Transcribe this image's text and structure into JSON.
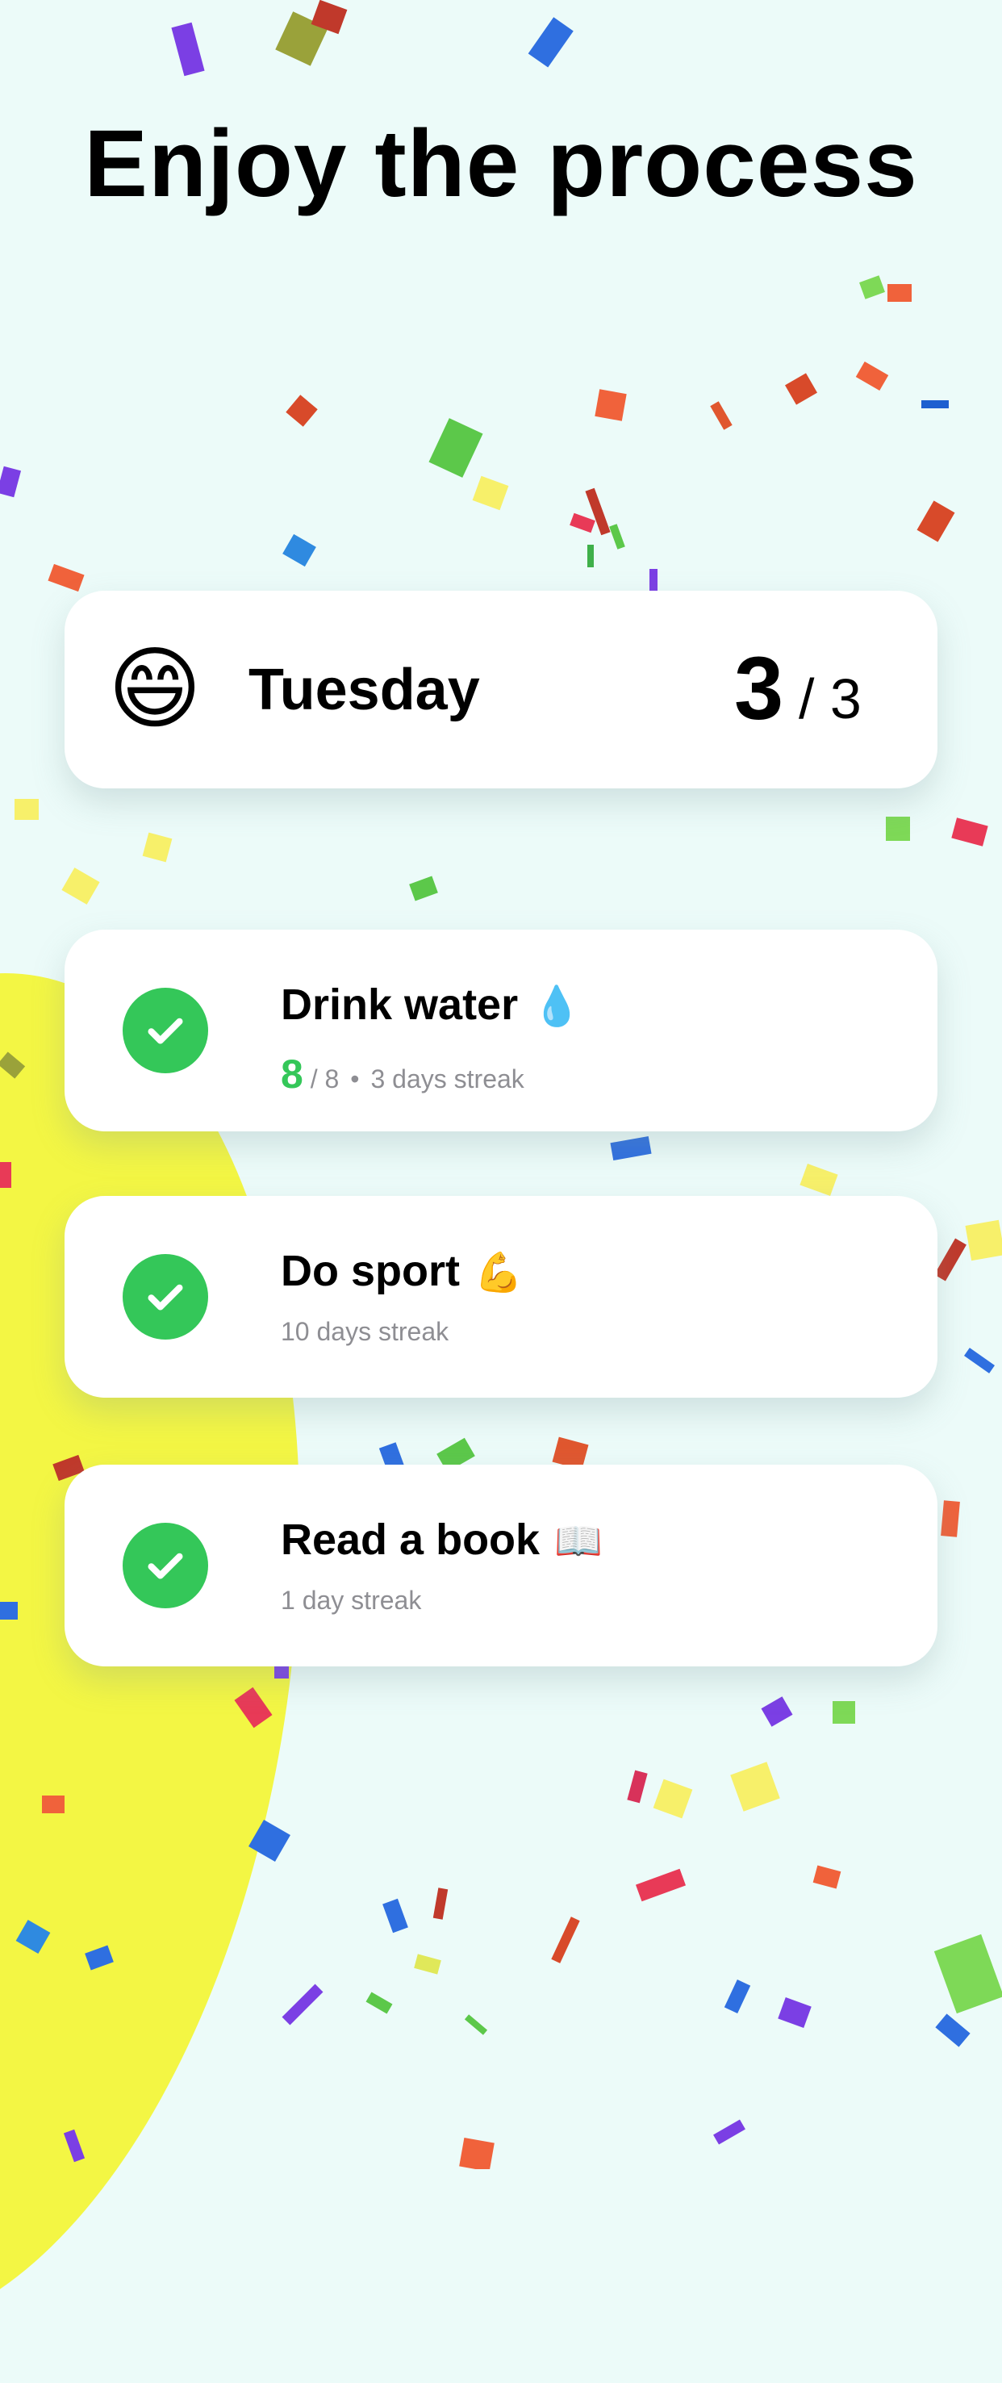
{
  "title": "Enjoy the process",
  "day_card": {
    "emoji": "😄",
    "day": "Tuesday",
    "completed": "3",
    "total": "/ 3"
  },
  "habits": [
    {
      "title": "Drink water",
      "emoji": "💧",
      "progress_done": "8",
      "progress_total": "/ 8",
      "separator": "•",
      "streak": "3 days streak"
    },
    {
      "title": "Do sport",
      "emoji": "💪",
      "streak": "10 days streak"
    },
    {
      "title": "Read a book",
      "emoji": "📖",
      "streak": "1 day streak"
    }
  ],
  "colors": {
    "background": "#ecfbf9",
    "blob": "#f3f644",
    "check_green": "#34c759",
    "muted_text": "#8e8e93"
  },
  "icons": {
    "check": "checkmark-icon"
  }
}
